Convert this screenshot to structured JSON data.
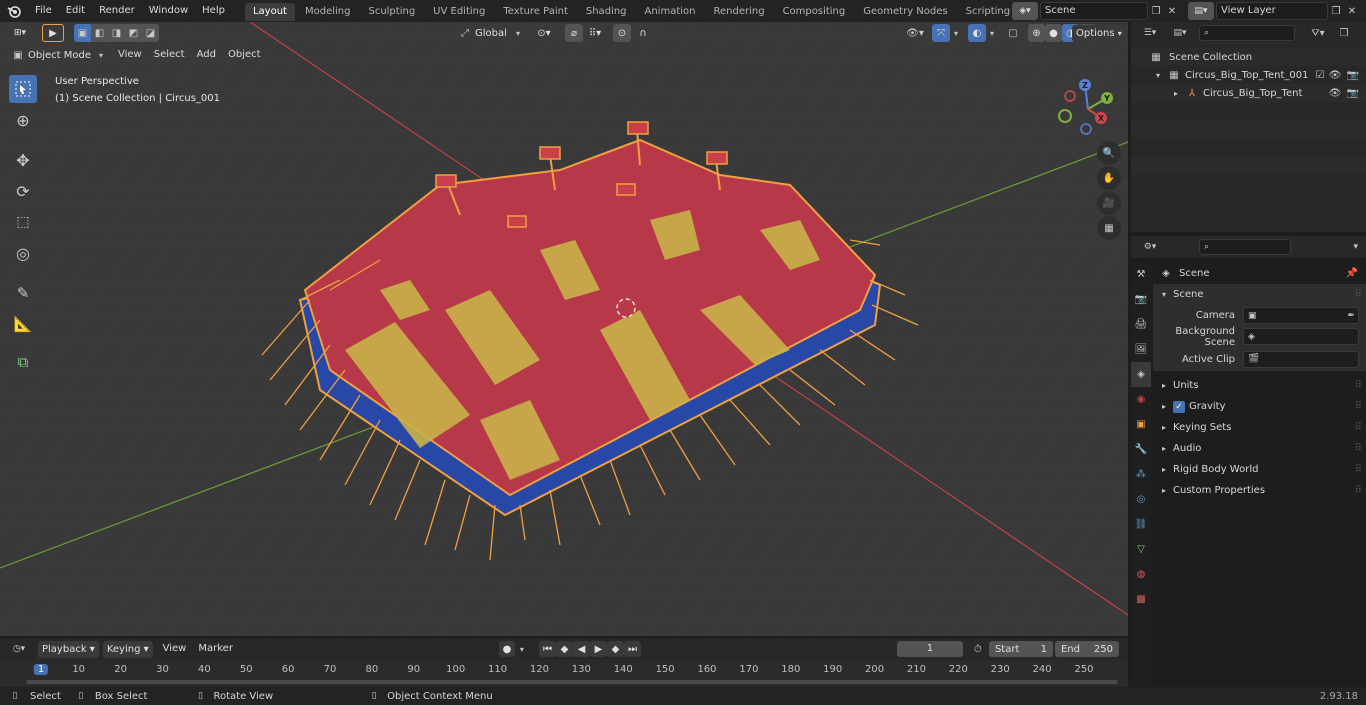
{
  "topbar": {
    "menus": [
      "File",
      "Edit",
      "Render",
      "Window",
      "Help"
    ],
    "workspaces": [
      "Layout",
      "Modeling",
      "Sculpting",
      "UV Editing",
      "Texture Paint",
      "Shading",
      "Animation",
      "Rendering",
      "Compositing",
      "Geometry Nodes",
      "Scripting"
    ],
    "active_workspace": "Layout",
    "scene_name": "Scene",
    "view_layer": "View Layer"
  },
  "viewport": {
    "mode": "Object Mode",
    "menus": [
      "View",
      "Select",
      "Add",
      "Object"
    ],
    "transform_orientation": "Global",
    "options_label": "Options",
    "perspective_label": "User Perspective",
    "collection_label": "(1) Scene Collection | Circus_001",
    "gizmo_axes": [
      "X",
      "Y",
      "Z"
    ]
  },
  "outliner": {
    "root": "Scene Collection",
    "items": [
      {
        "name": "Circus_Big_Top_Tent_001",
        "level": 1
      },
      {
        "name": "Circus_Big_Top_Tent",
        "level": 2
      }
    ]
  },
  "properties": {
    "context": "Scene",
    "panel_title": "Scene",
    "fields": [
      {
        "label": "Camera",
        "value": ""
      },
      {
        "label": "Background Scene",
        "value": ""
      },
      {
        "label": "Active Clip",
        "value": ""
      }
    ],
    "subpanels": [
      "Units",
      "Gravity",
      "Keying Sets",
      "Audio",
      "Rigid Body World",
      "Custom Properties"
    ],
    "gravity_checked": true
  },
  "timeline": {
    "menus": [
      "Playback",
      "Keying",
      "View",
      "Marker"
    ],
    "current_frame": "1",
    "start_label": "Start",
    "start": "1",
    "end_label": "End",
    "end": "250",
    "ticks": [
      "1",
      "10",
      "20",
      "30",
      "40",
      "50",
      "60",
      "70",
      "80",
      "90",
      "100",
      "110",
      "120",
      "130",
      "140",
      "150",
      "160",
      "170",
      "180",
      "190",
      "200",
      "210",
      "220",
      "230",
      "240",
      "250"
    ]
  },
  "statusbar": {
    "select": "Select",
    "box_select": "Box Select",
    "rotate_view": "Rotate View",
    "context_menu": "Object Context Menu",
    "version": "2.93.18"
  },
  "colors": {
    "accent": "#4772b3",
    "tent_red": "#b73848",
    "tent_yellow": "#c9b34a",
    "tent_blue": "#2848a8",
    "selection_orange": "#f0a040",
    "axis_x": "#d4454f",
    "axis_y": "#7fb23c"
  }
}
